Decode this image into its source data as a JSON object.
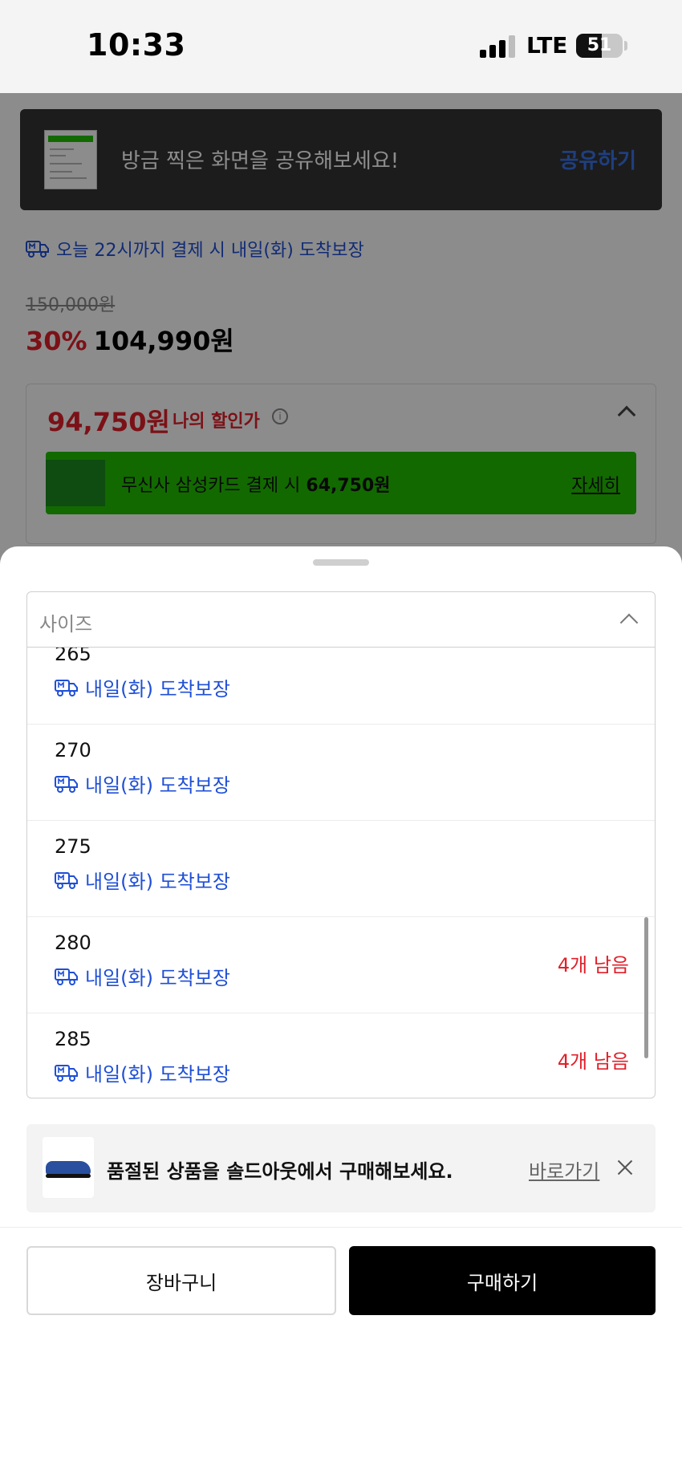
{
  "status_bar": {
    "time": "10:33",
    "network": "LTE",
    "battery": "51"
  },
  "share_banner": {
    "text": "방금 찍은 화면을 공유해보세요!",
    "action": "공유하기"
  },
  "product": {
    "delivery_guarantee": "오늘 22시까지 결제 시 내일(화) 도착보장",
    "original_price": "150,000원",
    "discount_rate": "30%",
    "sale_price": "104,990원",
    "my_price": "94,750원",
    "my_price_label": "나의 할인가",
    "card_offer_prefix": "무신사 삼성카드 결제 시",
    "card_offer_price": "64,750원",
    "card_offer_link": "자세히"
  },
  "sheet": {
    "select_label": "사이즈",
    "sizes": [
      {
        "size": "265",
        "delivery": "내일(화) 도착보장",
        "stock": ""
      },
      {
        "size": "270",
        "delivery": "내일(화) 도착보장",
        "stock": ""
      },
      {
        "size": "275",
        "delivery": "내일(화) 도착보장",
        "stock": ""
      },
      {
        "size": "280",
        "delivery": "내일(화) 도착보장",
        "stock": "4개 남음"
      },
      {
        "size": "285",
        "delivery": "내일(화) 도착보장",
        "stock": "4개 남음"
      }
    ],
    "soldout_banner": {
      "text": "품절된 상품을 솔드아웃에서 구매해보세요.",
      "link": "바로가기"
    },
    "cart_button": "장바구니",
    "buy_button": "구매하기"
  },
  "colors": {
    "accent_blue": "#1f4fd6",
    "sale_red": "#e0202a",
    "card_green": "#22c000"
  }
}
